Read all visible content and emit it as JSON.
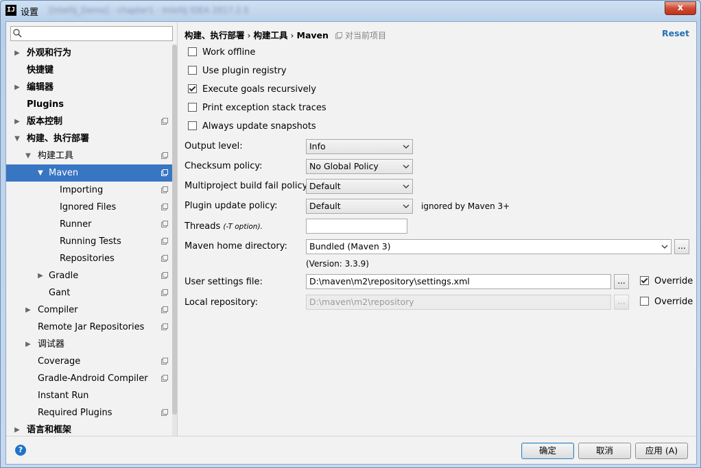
{
  "window": {
    "title": "设置",
    "blurred_title": "[Intellij_Demo] - chapter1 - IntelliJ IDEA 2017.2.5",
    "close_glyph": "x"
  },
  "sidebar": {
    "search": {
      "value": "",
      "placeholder": ""
    },
    "items": [
      {
        "label": "外观和行为"
      },
      {
        "label": "快捷键"
      },
      {
        "label": "编辑器"
      },
      {
        "label": "Plugins"
      },
      {
        "label": "版本控制"
      },
      {
        "label": "构建、执行部署"
      },
      {
        "label": "构建工具"
      },
      {
        "label": "Maven"
      },
      {
        "label": "Importing"
      },
      {
        "label": "Ignored Files"
      },
      {
        "label": "Runner"
      },
      {
        "label": "Running Tests"
      },
      {
        "label": "Repositories"
      },
      {
        "label": "Gradle"
      },
      {
        "label": "Gant"
      },
      {
        "label": "Compiler"
      },
      {
        "label": "Remote Jar Repositories"
      },
      {
        "label": "调试器"
      },
      {
        "label": "Coverage"
      },
      {
        "label": "Gradle-Android Compiler"
      },
      {
        "label": "Instant Run"
      },
      {
        "label": "Required Plugins"
      },
      {
        "label": "语言和框架"
      }
    ]
  },
  "breadcrumb": {
    "part1": "构建、执行部署",
    "sep": "›",
    "part2": "构建工具",
    "part3": "Maven",
    "project_note": "对当前项目"
  },
  "reset_label": "Reset",
  "checkboxes": [
    {
      "label": "Work offline",
      "checked": false
    },
    {
      "label": "Use plugin registry",
      "checked": false
    },
    {
      "label": "Execute goals recursively",
      "checked": true
    },
    {
      "label": "Print exception stack traces",
      "checked": false
    },
    {
      "label": "Always update snapshots",
      "checked": false
    }
  ],
  "fields": {
    "output_level": {
      "label": "Output level:",
      "value": "Info"
    },
    "checksum_policy": {
      "label": "Checksum policy:",
      "value": "No Global Policy"
    },
    "multiproject_fail_policy": {
      "label": "Multiproject build fail policy:",
      "value": "Default"
    },
    "plugin_update_policy": {
      "label": "Plugin update policy:",
      "value": "Default",
      "note": "ignored by Maven 3+"
    },
    "threads": {
      "label": "Threads",
      "hint": "(-T option).",
      "value": ""
    },
    "maven_home": {
      "label": "Maven home directory:",
      "value": "Bundled (Maven 3)",
      "browse": "...",
      "version": "(Version: 3.3.9)"
    },
    "user_settings": {
      "label": "User settings file:",
      "value": "D:\\maven\\m2\\repository\\settings.xml",
      "browse": "...",
      "override_label": "Override",
      "override": true
    },
    "local_repository": {
      "label": "Local repository:",
      "value": "D:\\maven\\m2\\repository",
      "browse": "...",
      "override_label": "Override",
      "override": false
    }
  },
  "buttons": {
    "help": "?",
    "ok": "确定",
    "cancel": "取消",
    "apply": "应用 (A)"
  },
  "colors": {
    "selection": "#3875c3",
    "link": "#2470b3",
    "help": "#1e73c8"
  }
}
